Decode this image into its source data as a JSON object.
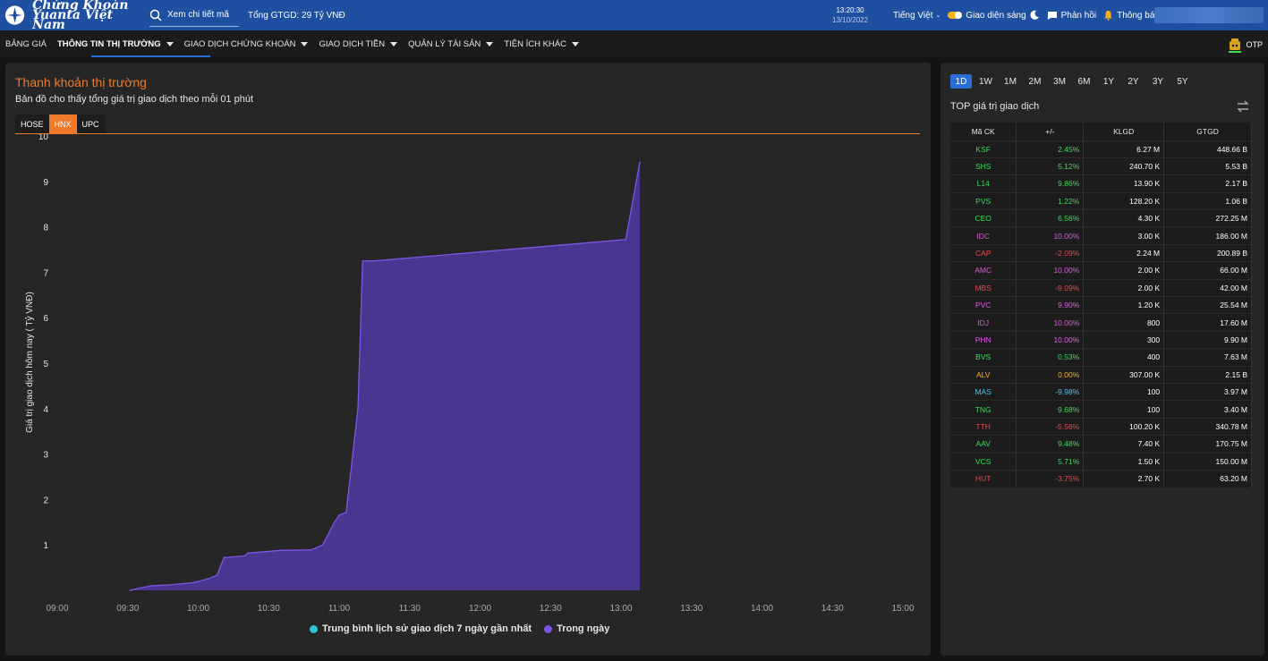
{
  "header": {
    "logo_line1": "Chứng Khoán",
    "logo_line2": "Yuanta Việt Nam",
    "search_placeholder": "Xem chi tiết mã",
    "total_value": "Tổng GTGD: 29 Tỷ VNĐ",
    "time": "13:20:30",
    "date": "13/10/2022",
    "language": "Tiếng Việt",
    "theme_label": "Giao diện sáng",
    "feedback_label": "Phản hồi",
    "notify_label": "Thông báo"
  },
  "nav": {
    "items": [
      "BẢNG GIÁ",
      "THÔNG TIN THỊ TRƯỜNG",
      "GIAO DỊCH CHỨNG KHOÁN",
      "GIAO DỊCH TIỀN",
      "QUẢN LÝ TÀI SẢN",
      "TIỆN ÍCH KHÁC"
    ],
    "otp_label": "OTP"
  },
  "liquidity": {
    "title": "Thanh khoản thị trường",
    "subtitle": "Bản đồ cho thấy tổng giá trị giao dịch theo mỗi 01 phút",
    "tabs": [
      "HOSE",
      "HNX",
      "UPC"
    ],
    "active_tab": "HNX",
    "legend": [
      {
        "label": "Trung bình lịch sử giao dịch 7 ngày gần nhất",
        "color": "#2ec4d6"
      },
      {
        "label": "Trong ngày",
        "color": "#7b55e6"
      }
    ]
  },
  "chart_data": {
    "type": "area",
    "title": "",
    "xlabel": "",
    "ylabel": "Giá trị giao dịch hôm nay ( Tỷ VNĐ)",
    "x_ticks": [
      "09:00",
      "09:30",
      "10:00",
      "10:30",
      "11:00",
      "11:30",
      "12:00",
      "12:30",
      "13:00",
      "13:30",
      "14:00",
      "14:30",
      "15:00"
    ],
    "y_ticks": [
      1,
      2,
      3,
      4,
      5,
      6,
      7,
      8,
      9,
      10
    ],
    "ylim": [
      0,
      10
    ],
    "xlim": [
      "09:00",
      "15:00"
    ],
    "grid": false,
    "legend_position": "bottom",
    "series": [
      {
        "name": "Trong ngày",
        "color": "#7b55e6",
        "points": [
          [
            "09:31",
            0.0
          ],
          [
            "09:35",
            0.05
          ],
          [
            "09:40",
            0.1
          ],
          [
            "09:48",
            0.12
          ],
          [
            "09:58",
            0.17
          ],
          [
            "10:04",
            0.25
          ],
          [
            "10:08",
            0.33
          ],
          [
            "10:11",
            0.72
          ],
          [
            "10:20",
            0.76
          ],
          [
            "10:21",
            0.82
          ],
          [
            "10:26",
            0.84
          ],
          [
            "10:35",
            0.88
          ],
          [
            "10:48",
            0.89
          ],
          [
            "10:53",
            1.0
          ],
          [
            "10:58",
            1.5
          ],
          [
            "11:00",
            1.65
          ],
          [
            "11:03",
            1.72
          ],
          [
            "11:08",
            4.0
          ],
          [
            "11:10",
            7.25
          ],
          [
            "11:15",
            7.25
          ],
          [
            "13:02",
            7.72
          ],
          [
            "13:08",
            9.42
          ]
        ]
      }
    ]
  },
  "top": {
    "periods": [
      "1D",
      "1W",
      "1M",
      "2M",
      "3M",
      "6M",
      "1Y",
      "2Y",
      "3Y",
      "5Y"
    ],
    "active_period": "1D",
    "title": "TOP giá trị giao dịch",
    "columns": [
      "Mã CK",
      "+/-",
      "KLGD",
      "GTGD"
    ],
    "rows": [
      {
        "sym": "KSF",
        "chg": "2.45%",
        "vol": "6.27 M",
        "val": "448.66 B",
        "color": "#3ddc5a"
      },
      {
        "sym": "SHS",
        "chg": "5.12%",
        "vol": "240.70 K",
        "val": "5.53 B",
        "color": "#3ddc5a"
      },
      {
        "sym": "L14",
        "chg": "9.86%",
        "vol": "13.90 K",
        "val": "2.17 B",
        "color": "#3ddc5a"
      },
      {
        "sym": "PVS",
        "chg": "1.22%",
        "vol": "128.20 K",
        "val": "1.06 B",
        "color": "#3ddc5a"
      },
      {
        "sym": "CEO",
        "chg": "6.56%",
        "vol": "4.30 K",
        "val": "272.25 M",
        "color": "#3ddc5a"
      },
      {
        "sym": "IDC",
        "chg": "10.00%",
        "vol": "3.00 K",
        "val": "186.00 M",
        "color": "#e05ce0"
      },
      {
        "sym": "CAP",
        "chg": "-2.09%",
        "vol": "2.24 M",
        "val": "200.89 B",
        "color": "#f04848"
      },
      {
        "sym": "AMC",
        "chg": "10.00%",
        "vol": "2.00 K",
        "val": "66.00 M",
        "color": "#e05ce0"
      },
      {
        "sym": "MBS",
        "chg": "-9.09%",
        "vol": "2.00 K",
        "val": "42.00 M",
        "color": "#f04848"
      },
      {
        "sym": "PVC",
        "chg": "9.90%",
        "vol": "1.20 K",
        "val": "25.54 M",
        "color": "#e05ce0"
      },
      {
        "sym": "IDJ",
        "chg": "10.00%",
        "vol": "800",
        "val": "17.60 M",
        "color": "#e05ce0"
      },
      {
        "sym": "PHN",
        "chg": "10.00%",
        "vol": "300",
        "val": "9.90 M",
        "color": "#e05ce0"
      },
      {
        "sym": "BVS",
        "chg": "0.53%",
        "vol": "400",
        "val": "7.63 M",
        "color": "#3ddc5a"
      },
      {
        "sym": "ALV",
        "chg": "0.00%",
        "vol": "307.00 K",
        "val": "2.15 B",
        "color": "#f6b21b"
      },
      {
        "sym": "MAS",
        "chg": "-9.98%",
        "vol": "100",
        "val": "3.97 M",
        "color": "#4fc3f7"
      },
      {
        "sym": "TNG",
        "chg": "9.68%",
        "vol": "100",
        "val": "3.40 M",
        "color": "#3ddc5a"
      },
      {
        "sym": "TTH",
        "chg": "-5.56%",
        "vol": "100.20 K",
        "val": "340.78 M",
        "color": "#f04848"
      },
      {
        "sym": "AAV",
        "chg": "9.48%",
        "vol": "7.40 K",
        "val": "170.75 M",
        "color": "#3ddc5a"
      },
      {
        "sym": "VCS",
        "chg": "5.71%",
        "vol": "1.50 K",
        "val": "150.00 M",
        "color": "#3ddc5a"
      },
      {
        "sym": "HUT",
        "chg": "-3.75%",
        "vol": "2.70 K",
        "val": "63.20 M",
        "color": "#f04848"
      }
    ]
  }
}
